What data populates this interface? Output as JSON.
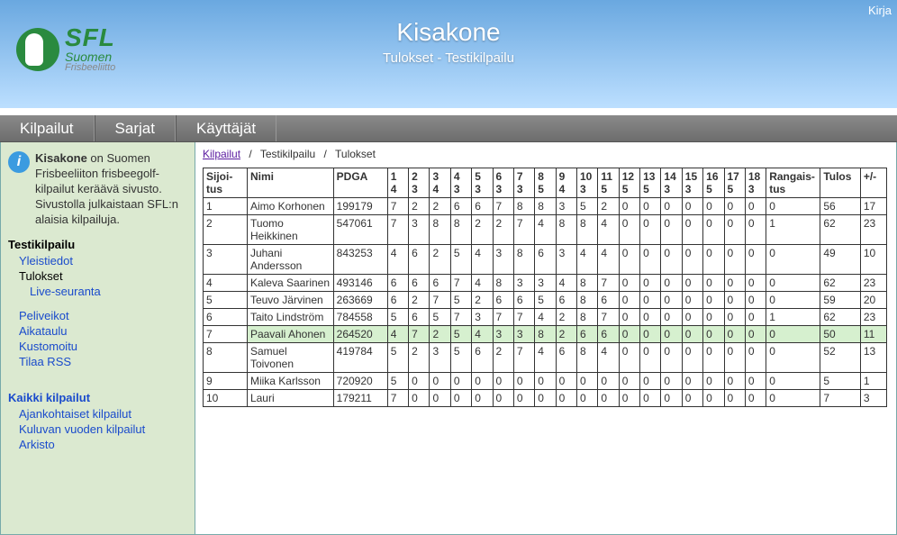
{
  "login_link": "Kirja",
  "logo": {
    "l1": "SFL",
    "l2": "Suomen",
    "l3": "Frisbeeliitto"
  },
  "hero": {
    "title": "Kisakone",
    "subtitle": "Tulokset - Testikilpailu"
  },
  "nav": [
    "Kilpailut",
    "Sarjat",
    "Käyttäjät"
  ],
  "info": {
    "bold": "Kisakone",
    "rest": " on Suomen Frisbeeliiton frisbeegolf-kilpailut keräävä sivusto. Sivustolla julkaistaan SFL:n alaisia kilpailuja."
  },
  "side": {
    "event": "Testikilpailu",
    "links1": [
      "Yleistiedot"
    ],
    "current": "Tulokset",
    "sub": [
      "Live-seuranta"
    ],
    "links2": [
      "Peliveikot",
      "Aikataulu",
      "Kustomoitu",
      "Tilaa RSS"
    ],
    "all_head": "Kaikki kilpailut",
    "all": [
      "Ajankohtaiset kilpailut",
      "Kuluvan vuoden kilpailut",
      "Arkisto"
    ]
  },
  "crumbs": [
    {
      "label": "Kilpailut",
      "link": true
    },
    {
      "label": "Testikilpailu",
      "link": false
    },
    {
      "label": "Tulokset",
      "link": false
    }
  ],
  "table": {
    "head": {
      "pos": "Sijoi-\ntus",
      "name": "Nimi",
      "pdga": "PDGA",
      "holes": [
        "1 4",
        "2 3",
        "3 4",
        "4 3",
        "5 3",
        "6 3",
        "7 3",
        "8 5",
        "9 4",
        "10 3",
        "11 5",
        "12 5",
        "13 5",
        "14 3",
        "15 3",
        "16 5",
        "17 5",
        "18 3"
      ],
      "pen": "Rangais-\ntus",
      "tul": "Tulos",
      "pm": "+/-"
    },
    "rows": [
      {
        "hi": false,
        "pos": "1",
        "name": "Aimo Korhonen",
        "pdga": "199179",
        "h": [
          "7",
          "2",
          "2",
          "6",
          "6",
          "7",
          "8",
          "8",
          "3",
          "5",
          "2",
          "0",
          "0",
          "0",
          "0",
          "0",
          "0",
          "0"
        ],
        "pen": "0",
        "tul": "56",
        "pm": "17"
      },
      {
        "hi": false,
        "pos": "2",
        "name": "Tuomo Heikkinen",
        "pdga": "547061",
        "h": [
          "7",
          "3",
          "8",
          "8",
          "2",
          "2",
          "7",
          "4",
          "8",
          "8",
          "4",
          "0",
          "0",
          "0",
          "0",
          "0",
          "0",
          "0"
        ],
        "pen": "1",
        "tul": "62",
        "pm": "23"
      },
      {
        "hi": false,
        "pos": "3",
        "name": "Juhani Andersson",
        "pdga": "843253",
        "h": [
          "4",
          "6",
          "2",
          "5",
          "4",
          "3",
          "8",
          "6",
          "3",
          "4",
          "4",
          "0",
          "0",
          "0",
          "0",
          "0",
          "0",
          "0"
        ],
        "pen": "0",
        "tul": "49",
        "pm": "10"
      },
      {
        "hi": false,
        "pos": "4",
        "name": "Kaleva Saarinen",
        "pdga": "493146",
        "h": [
          "6",
          "6",
          "6",
          "7",
          "4",
          "8",
          "3",
          "3",
          "4",
          "8",
          "7",
          "0",
          "0",
          "0",
          "0",
          "0",
          "0",
          "0"
        ],
        "pen": "0",
        "tul": "62",
        "pm": "23"
      },
      {
        "hi": false,
        "pos": "5",
        "name": "Teuvo Järvinen",
        "pdga": "263669",
        "h": [
          "6",
          "2",
          "7",
          "5",
          "2",
          "6",
          "6",
          "5",
          "6",
          "8",
          "6",
          "0",
          "0",
          "0",
          "0",
          "0",
          "0",
          "0"
        ],
        "pen": "0",
        "tul": "59",
        "pm": "20"
      },
      {
        "hi": false,
        "pos": "6",
        "name": "Taito Lindström",
        "pdga": "784558",
        "h": [
          "5",
          "6",
          "5",
          "7",
          "3",
          "7",
          "7",
          "4",
          "2",
          "8",
          "7",
          "0",
          "0",
          "0",
          "0",
          "0",
          "0",
          "0"
        ],
        "pen": "1",
        "tul": "62",
        "pm": "23"
      },
      {
        "hi": true,
        "pos": "7",
        "name": "Paavali Ahonen",
        "pdga": "264520",
        "h": [
          "4",
          "7",
          "2",
          "5",
          "4",
          "3",
          "3",
          "8",
          "2",
          "6",
          "6",
          "0",
          "0",
          "0",
          "0",
          "0",
          "0",
          "0"
        ],
        "pen": "0",
        "tul": "50",
        "pm": "11"
      },
      {
        "hi": false,
        "pos": "8",
        "name": "Samuel Toivonen",
        "pdga": "419784",
        "h": [
          "5",
          "2",
          "3",
          "5",
          "6",
          "2",
          "7",
          "4",
          "6",
          "8",
          "4",
          "0",
          "0",
          "0",
          "0",
          "0",
          "0",
          "0"
        ],
        "pen": "0",
        "tul": "52",
        "pm": "13"
      },
      {
        "hi": false,
        "pos": "9",
        "name": "Miika Karlsson",
        "pdga": "720920",
        "h": [
          "5",
          "0",
          "0",
          "0",
          "0",
          "0",
          "0",
          "0",
          "0",
          "0",
          "0",
          "0",
          "0",
          "0",
          "0",
          "0",
          "0",
          "0"
        ],
        "pen": "0",
        "tul": "5",
        "pm": "1"
      },
      {
        "hi": false,
        "pos": "10",
        "name": "Lauri",
        "pdga": "179211",
        "h": [
          "7",
          "0",
          "0",
          "0",
          "0",
          "0",
          "0",
          "0",
          "0",
          "0",
          "0",
          "0",
          "0",
          "0",
          "0",
          "0",
          "0",
          "0"
        ],
        "pen": "0",
        "tul": "7",
        "pm": "3"
      }
    ]
  }
}
